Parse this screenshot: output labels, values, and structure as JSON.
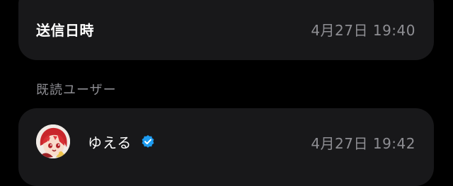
{
  "sent": {
    "label": "送信日時",
    "value": "4月27日 19:40"
  },
  "read_section": {
    "header": "既読ユーザー"
  },
  "read_users": [
    {
      "name": "ゆえる",
      "verified": true,
      "time": "4月27日 19:42"
    }
  ],
  "colors": {
    "background": "#000000",
    "card": "#18181a",
    "secondary_text": "#8e8e93",
    "verified_badge": "#1d9bf0"
  }
}
